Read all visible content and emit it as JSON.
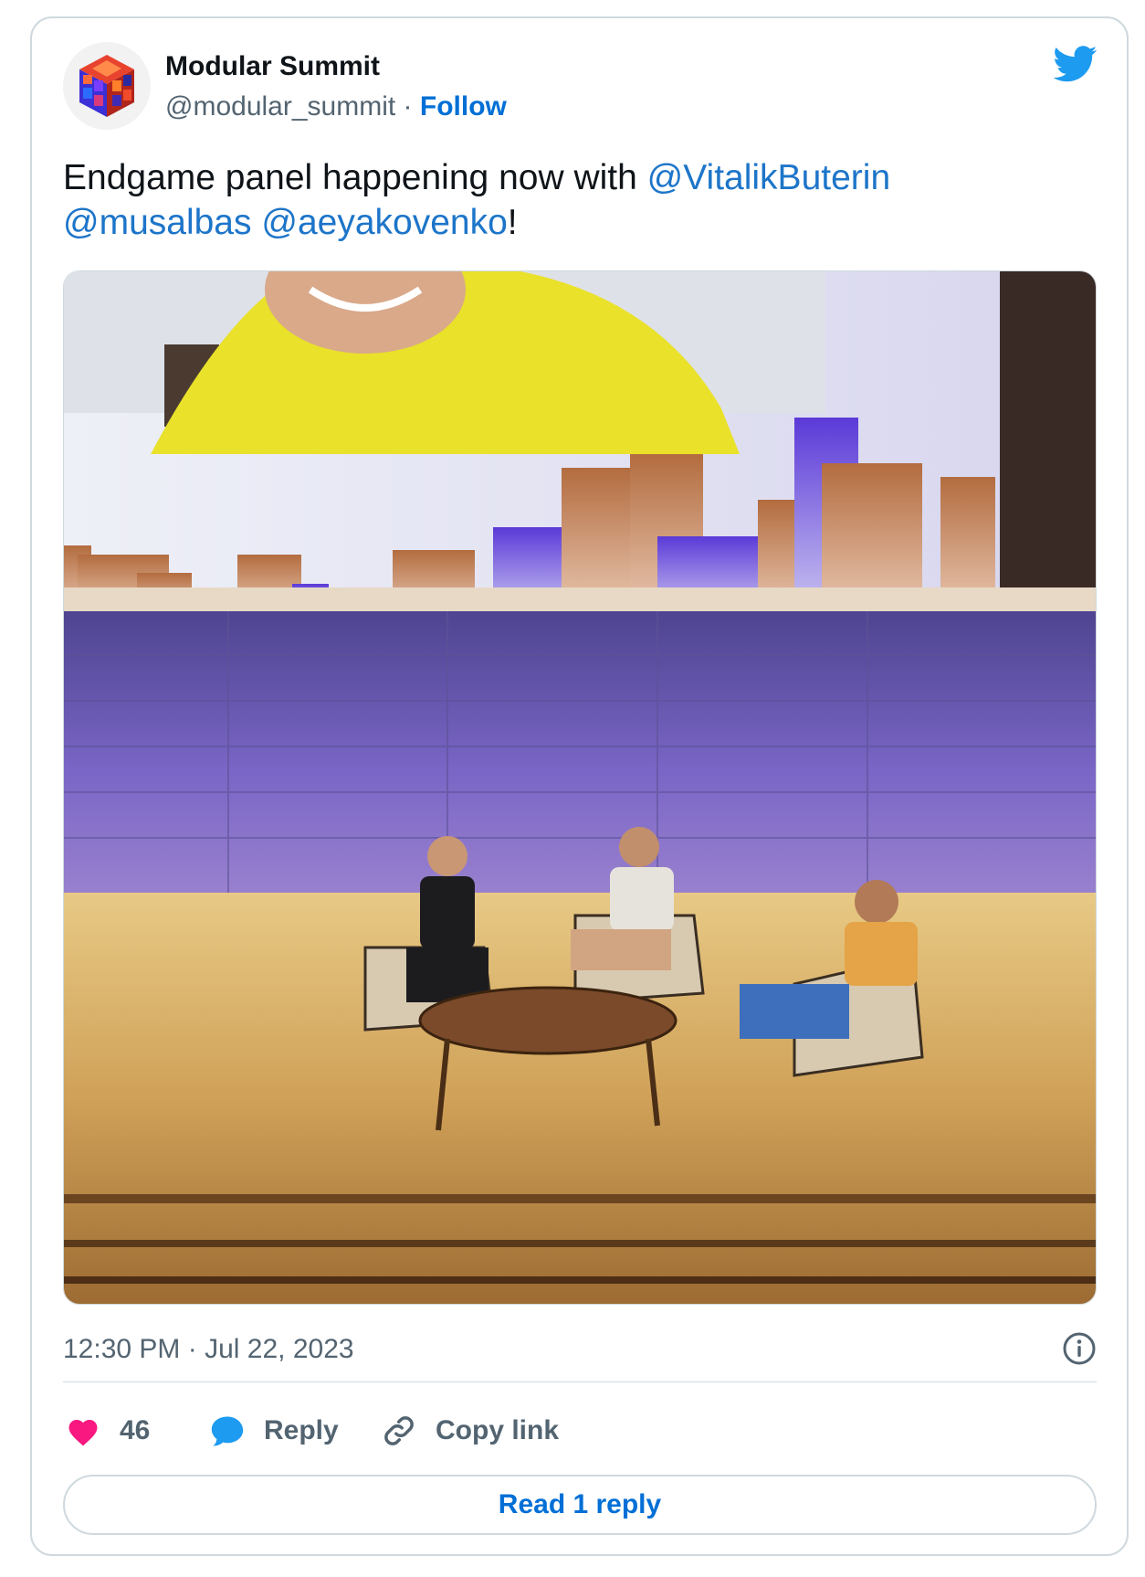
{
  "account": {
    "name": "Modular Summit",
    "handle": "@modular_summit",
    "separator": "·",
    "follow_label": "Follow",
    "avatar_icon": "modular-cube-logo",
    "platform_icon": "twitter-bird-icon"
  },
  "tweet": {
    "text_before": "Endgame panel happening now with ",
    "mentions": [
      "@VitalikButerin",
      "@musalbas",
      "@aeyakovenko"
    ],
    "text_after": "!",
    "media_icon": "photo-panel-on-stage"
  },
  "meta": {
    "time": "12:30 PM",
    "separator": "·",
    "date": "Jul 22, 2023",
    "info_icon": "info-icon"
  },
  "actions": {
    "like_count": "46",
    "reply_label": "Reply",
    "copy_label": "Copy link"
  },
  "read_replies_label": "Read 1 reply",
  "colors": {
    "link": "#1d75c9",
    "follow": "#006fd6",
    "heart": "#f91880",
    "reply": "#1d9bf0",
    "border": "#cfd9de",
    "muted": "#536471"
  }
}
